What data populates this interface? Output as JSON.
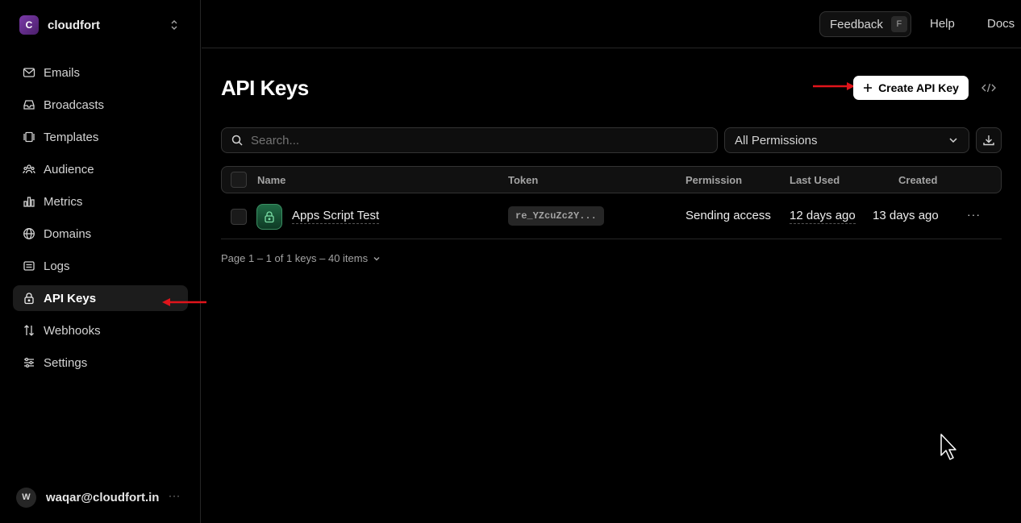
{
  "team": {
    "initial": "C",
    "name": "cloudfort"
  },
  "nav": [
    {
      "label": "Emails",
      "icon": "mail-icon"
    },
    {
      "label": "Broadcasts",
      "icon": "inbox-icon"
    },
    {
      "label": "Templates",
      "icon": "template-icon"
    },
    {
      "label": "Audience",
      "icon": "users-icon"
    },
    {
      "label": "Metrics",
      "icon": "bar-chart-icon"
    },
    {
      "label": "Domains",
      "icon": "globe-icon"
    },
    {
      "label": "Logs",
      "icon": "list-icon"
    },
    {
      "label": "API Keys",
      "icon": "lock-icon",
      "active": true
    },
    {
      "label": "Webhooks",
      "icon": "webhook-icon"
    },
    {
      "label": "Settings",
      "icon": "sliders-icon"
    }
  ],
  "user": {
    "initial": "W",
    "email": "waqar@cloudfort.in",
    "more": "···"
  },
  "topbar": {
    "feedback": "Feedback",
    "feedback_key": "F",
    "help": "Help",
    "docs": "Docs"
  },
  "page": {
    "title": "API Keys",
    "create_label": "Create API Key",
    "search_placeholder": "Search...",
    "permission_filter": "All Permissions"
  },
  "table": {
    "headers": {
      "name": "Name",
      "token": "Token",
      "permission": "Permission",
      "last_used": "Last Used",
      "created": "Created"
    },
    "rows": [
      {
        "name": "Apps Script Test",
        "token": "re_YZcuZc2Y...",
        "permission": "Sending access",
        "last_used": "12 days ago",
        "created": "13 days ago",
        "more": "···"
      }
    ]
  },
  "pagination": {
    "text": "Page 1 – 1 of 1 keys – 40 items"
  },
  "colors": {
    "accent": "#ffffff",
    "annotation_arrow": "#e0141b",
    "key_icon": "#1f6b45"
  }
}
